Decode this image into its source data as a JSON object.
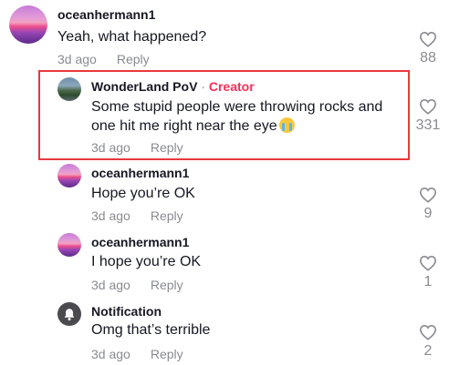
{
  "comments": [
    {
      "username": "oceanhermann1",
      "text": "Yeah, what happened?",
      "time": "3d ago",
      "reply_label": "Reply",
      "likes": "88"
    },
    {
      "username": "WonderLand PoV",
      "separator": "·",
      "creator_tag": "Creator",
      "text_line1": "Some stupid people were throwing rocks and",
      "text_line2": "one hit me right near the eye",
      "emoji": "crying-face-emoji",
      "time": "3d ago",
      "reply_label": "Reply",
      "likes": "331"
    },
    {
      "username": "oceanhermann1",
      "text": "Hope you’re OK",
      "time": "3d ago",
      "reply_label": "Reply",
      "likes": "9"
    },
    {
      "username": "oceanhermann1",
      "text": "I hope you’re OK",
      "time": "3d ago",
      "reply_label": "Reply",
      "likes": "1"
    },
    {
      "username": "Notification",
      "text": "Omg that’s terrible",
      "time": "3d ago",
      "reply_label": "Reply",
      "likes": "2"
    }
  ],
  "colors": {
    "creator_tag": "#fe2c55",
    "highlight_border": "#e8383d",
    "muted_text": "#8a8b91"
  }
}
